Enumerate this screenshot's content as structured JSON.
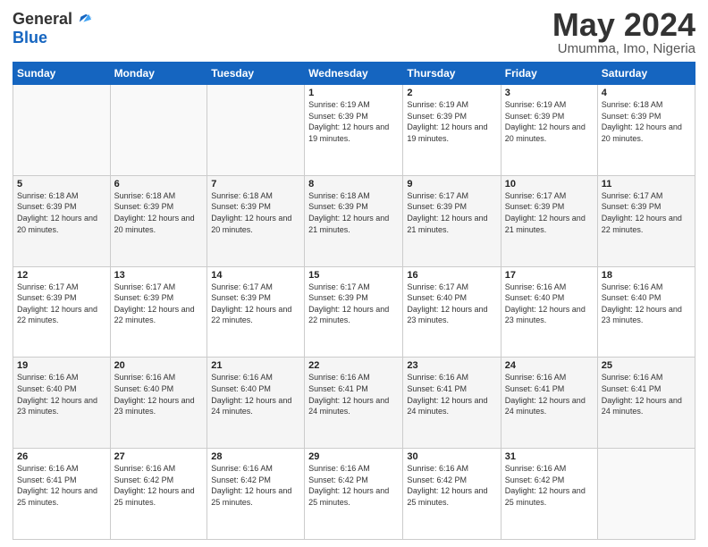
{
  "logo": {
    "general": "General",
    "blue": "Blue"
  },
  "header": {
    "month": "May 2024",
    "location": "Umumma, Imo, Nigeria"
  },
  "weekdays": [
    "Sunday",
    "Monday",
    "Tuesday",
    "Wednesday",
    "Thursday",
    "Friday",
    "Saturday"
  ],
  "weeks": [
    [
      {
        "day": "",
        "sunrise": "",
        "sunset": "",
        "daylight": ""
      },
      {
        "day": "",
        "sunrise": "",
        "sunset": "",
        "daylight": ""
      },
      {
        "day": "",
        "sunrise": "",
        "sunset": "",
        "daylight": ""
      },
      {
        "day": "1",
        "sunrise": "Sunrise: 6:19 AM",
        "sunset": "Sunset: 6:39 PM",
        "daylight": "Daylight: 12 hours and 19 minutes."
      },
      {
        "day": "2",
        "sunrise": "Sunrise: 6:19 AM",
        "sunset": "Sunset: 6:39 PM",
        "daylight": "Daylight: 12 hours and 19 minutes."
      },
      {
        "day": "3",
        "sunrise": "Sunrise: 6:19 AM",
        "sunset": "Sunset: 6:39 PM",
        "daylight": "Daylight: 12 hours and 20 minutes."
      },
      {
        "day": "4",
        "sunrise": "Sunrise: 6:18 AM",
        "sunset": "Sunset: 6:39 PM",
        "daylight": "Daylight: 12 hours and 20 minutes."
      }
    ],
    [
      {
        "day": "5",
        "sunrise": "Sunrise: 6:18 AM",
        "sunset": "Sunset: 6:39 PM",
        "daylight": "Daylight: 12 hours and 20 minutes."
      },
      {
        "day": "6",
        "sunrise": "Sunrise: 6:18 AM",
        "sunset": "Sunset: 6:39 PM",
        "daylight": "Daylight: 12 hours and 20 minutes."
      },
      {
        "day": "7",
        "sunrise": "Sunrise: 6:18 AM",
        "sunset": "Sunset: 6:39 PM",
        "daylight": "Daylight: 12 hours and 20 minutes."
      },
      {
        "day": "8",
        "sunrise": "Sunrise: 6:18 AM",
        "sunset": "Sunset: 6:39 PM",
        "daylight": "Daylight: 12 hours and 21 minutes."
      },
      {
        "day": "9",
        "sunrise": "Sunrise: 6:17 AM",
        "sunset": "Sunset: 6:39 PM",
        "daylight": "Daylight: 12 hours and 21 minutes."
      },
      {
        "day": "10",
        "sunrise": "Sunrise: 6:17 AM",
        "sunset": "Sunset: 6:39 PM",
        "daylight": "Daylight: 12 hours and 21 minutes."
      },
      {
        "day": "11",
        "sunrise": "Sunrise: 6:17 AM",
        "sunset": "Sunset: 6:39 PM",
        "daylight": "Daylight: 12 hours and 22 minutes."
      }
    ],
    [
      {
        "day": "12",
        "sunrise": "Sunrise: 6:17 AM",
        "sunset": "Sunset: 6:39 PM",
        "daylight": "Daylight: 12 hours and 22 minutes."
      },
      {
        "day": "13",
        "sunrise": "Sunrise: 6:17 AM",
        "sunset": "Sunset: 6:39 PM",
        "daylight": "Daylight: 12 hours and 22 minutes."
      },
      {
        "day": "14",
        "sunrise": "Sunrise: 6:17 AM",
        "sunset": "Sunset: 6:39 PM",
        "daylight": "Daylight: 12 hours and 22 minutes."
      },
      {
        "day": "15",
        "sunrise": "Sunrise: 6:17 AM",
        "sunset": "Sunset: 6:39 PM",
        "daylight": "Daylight: 12 hours and 22 minutes."
      },
      {
        "day": "16",
        "sunrise": "Sunrise: 6:17 AM",
        "sunset": "Sunset: 6:40 PM",
        "daylight": "Daylight: 12 hours and 23 minutes."
      },
      {
        "day": "17",
        "sunrise": "Sunrise: 6:16 AM",
        "sunset": "Sunset: 6:40 PM",
        "daylight": "Daylight: 12 hours and 23 minutes."
      },
      {
        "day": "18",
        "sunrise": "Sunrise: 6:16 AM",
        "sunset": "Sunset: 6:40 PM",
        "daylight": "Daylight: 12 hours and 23 minutes."
      }
    ],
    [
      {
        "day": "19",
        "sunrise": "Sunrise: 6:16 AM",
        "sunset": "Sunset: 6:40 PM",
        "daylight": "Daylight: 12 hours and 23 minutes."
      },
      {
        "day": "20",
        "sunrise": "Sunrise: 6:16 AM",
        "sunset": "Sunset: 6:40 PM",
        "daylight": "Daylight: 12 hours and 23 minutes."
      },
      {
        "day": "21",
        "sunrise": "Sunrise: 6:16 AM",
        "sunset": "Sunset: 6:40 PM",
        "daylight": "Daylight: 12 hours and 24 minutes."
      },
      {
        "day": "22",
        "sunrise": "Sunrise: 6:16 AM",
        "sunset": "Sunset: 6:41 PM",
        "daylight": "Daylight: 12 hours and 24 minutes."
      },
      {
        "day": "23",
        "sunrise": "Sunrise: 6:16 AM",
        "sunset": "Sunset: 6:41 PM",
        "daylight": "Daylight: 12 hours and 24 minutes."
      },
      {
        "day": "24",
        "sunrise": "Sunrise: 6:16 AM",
        "sunset": "Sunset: 6:41 PM",
        "daylight": "Daylight: 12 hours and 24 minutes."
      },
      {
        "day": "25",
        "sunrise": "Sunrise: 6:16 AM",
        "sunset": "Sunset: 6:41 PM",
        "daylight": "Daylight: 12 hours and 24 minutes."
      }
    ],
    [
      {
        "day": "26",
        "sunrise": "Sunrise: 6:16 AM",
        "sunset": "Sunset: 6:41 PM",
        "daylight": "Daylight: 12 hours and 25 minutes."
      },
      {
        "day": "27",
        "sunrise": "Sunrise: 6:16 AM",
        "sunset": "Sunset: 6:42 PM",
        "daylight": "Daylight: 12 hours and 25 minutes."
      },
      {
        "day": "28",
        "sunrise": "Sunrise: 6:16 AM",
        "sunset": "Sunset: 6:42 PM",
        "daylight": "Daylight: 12 hours and 25 minutes."
      },
      {
        "day": "29",
        "sunrise": "Sunrise: 6:16 AM",
        "sunset": "Sunset: 6:42 PM",
        "daylight": "Daylight: 12 hours and 25 minutes."
      },
      {
        "day": "30",
        "sunrise": "Sunrise: 6:16 AM",
        "sunset": "Sunset: 6:42 PM",
        "daylight": "Daylight: 12 hours and 25 minutes."
      },
      {
        "day": "31",
        "sunrise": "Sunrise: 6:16 AM",
        "sunset": "Sunset: 6:42 PM",
        "daylight": "Daylight: 12 hours and 25 minutes."
      },
      {
        "day": "",
        "sunrise": "",
        "sunset": "",
        "daylight": ""
      }
    ]
  ]
}
